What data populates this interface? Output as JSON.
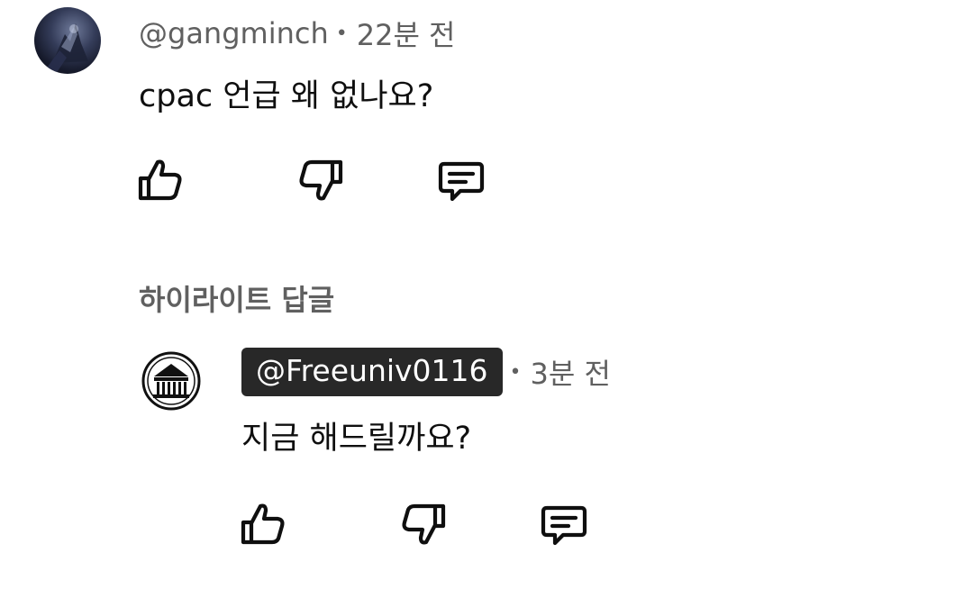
{
  "comment": {
    "author": "@gangminch",
    "separator": "•",
    "time": "22분 전",
    "text": "cpac 언급 왜 없나요?",
    "actions": [
      "like-icon",
      "dislike-icon",
      "reply-icon"
    ]
  },
  "replies_section": {
    "label": "하이라이트 답글"
  },
  "reply": {
    "author": "@Freeuniv0116",
    "separator": "•",
    "time": "3분 전",
    "text": "지금 해드릴까요?",
    "actions": [
      "like-icon",
      "dislike-icon",
      "reply-icon"
    ]
  },
  "colors": {
    "text_primary": "#0f0f0f",
    "text_secondary": "#606060",
    "creator_badge": "#282828"
  }
}
